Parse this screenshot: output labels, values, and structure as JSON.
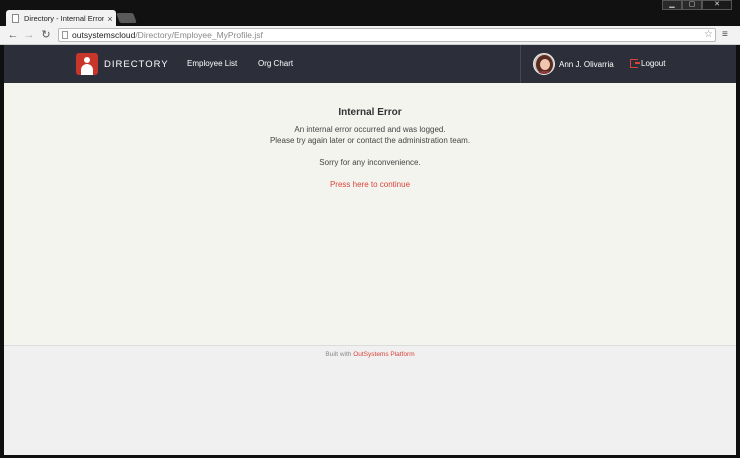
{
  "browser": {
    "tab_title": "Directory - Internal Error",
    "tab_close": "×",
    "url_host": "outsystemscloud",
    "url_path": "/Directory/Employee_MyProfile.jsf",
    "window_buttons": [
      "▁",
      "▢",
      "✕"
    ]
  },
  "header": {
    "brand": "DIRECTORY",
    "nav": [
      "Employee List",
      "Org Chart"
    ],
    "user_name": "Ann J. Olivarria",
    "logout": "Logout"
  },
  "error": {
    "title": "Internal Error",
    "line1": "An internal error occurred and was logged.",
    "line2": "Please try again later or contact the administration team.",
    "line3": "Sorry for any inconvenience.",
    "continue": "Press here to continue"
  },
  "footer": {
    "prefix": "Built with ",
    "link": "OutSystems Platform"
  },
  "colors": {
    "header_bg": "#2c2f3a",
    "accent": "#d9433a",
    "content_bg": "#f4f4ef"
  }
}
